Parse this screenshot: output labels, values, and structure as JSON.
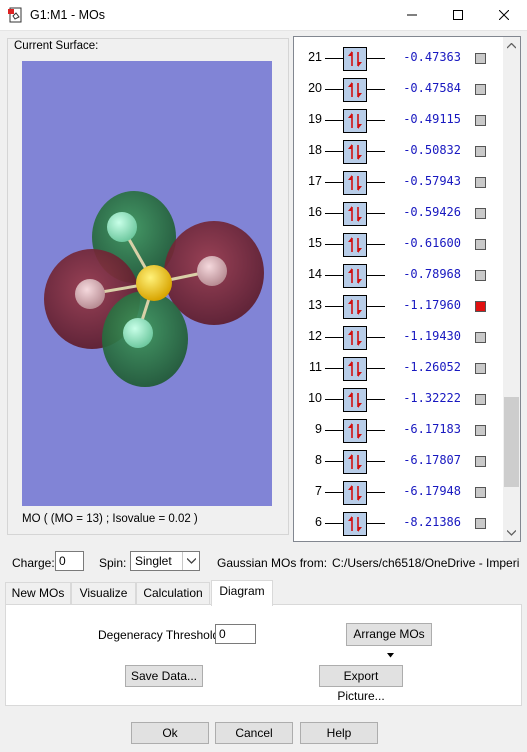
{
  "window": {
    "title": "G1:M1 - MOs"
  },
  "surface": {
    "group_label": "Current Surface:",
    "caption": "MO ( (MO = 13) ; Isovalue = 0.02 )"
  },
  "orbitals": [
    {
      "index": "21",
      "energy": "-0.47363",
      "selected": false
    },
    {
      "index": "20",
      "energy": "-0.47584",
      "selected": false
    },
    {
      "index": "19",
      "energy": "-0.49115",
      "selected": false
    },
    {
      "index": "18",
      "energy": "-0.50832",
      "selected": false
    },
    {
      "index": "17",
      "energy": "-0.57943",
      "selected": false
    },
    {
      "index": "16",
      "energy": "-0.59426",
      "selected": false
    },
    {
      "index": "15",
      "energy": "-0.61600",
      "selected": false
    },
    {
      "index": "14",
      "energy": "-0.78968",
      "selected": false
    },
    {
      "index": "13",
      "energy": "-1.17960",
      "selected": true
    },
    {
      "index": "12",
      "energy": "-1.19430",
      "selected": false
    },
    {
      "index": "11",
      "energy": "-1.26052",
      "selected": false
    },
    {
      "index": "10",
      "energy": "-1.32222",
      "selected": false
    },
    {
      "index": "9",
      "energy": "-6.17183",
      "selected": false
    },
    {
      "index": "8",
      "energy": "-6.17807",
      "selected": false
    },
    {
      "index": "7",
      "energy": "-6.17948",
      "selected": false
    },
    {
      "index": "6",
      "energy": "-8.21386",
      "selected": false
    }
  ],
  "controls": {
    "charge_label": "Charge:",
    "charge_value": "0",
    "spin_label": "Spin:",
    "spin_value": "Singlet",
    "source_label": "Gaussian MOs from:",
    "source_path": "C:/Users/ch6518/OneDrive - Imperi"
  },
  "tabs": [
    {
      "label": "New MOs"
    },
    {
      "label": "Visualize"
    },
    {
      "label": "Calculation"
    },
    {
      "label": "Diagram"
    }
  ],
  "diagram": {
    "threshold_label": "Degeneracy Threshold:",
    "threshold_value": "0",
    "arrange_label": "Arrange MOs",
    "save_label": "Save Data...",
    "export_label": "Export Picture..."
  },
  "dialog": {
    "ok": "Ok",
    "cancel": "Cancel",
    "help": "Help"
  },
  "colors": {
    "viewport_bg": "#8184d6",
    "energy_text": "#1818c0",
    "selected_marker": "#e01010",
    "lobe_red": "#7a2535",
    "lobe_green": "#2f7a45"
  }
}
